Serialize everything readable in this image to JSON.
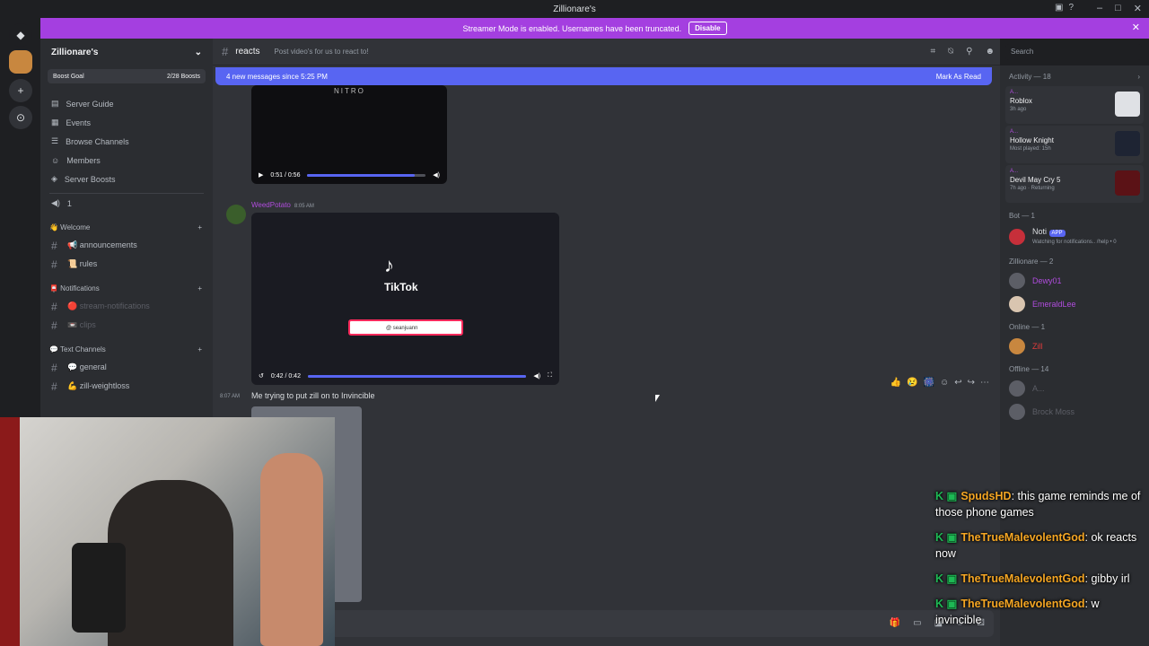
{
  "window": {
    "title": "Zillionare's"
  },
  "banner": {
    "text": "Streamer Mode is enabled. Usernames have been truncated.",
    "disable_label": "Disable"
  },
  "server": {
    "name": "Zillionare's",
    "boost_goal_label": "Boost Goal",
    "boost_count": "2/28 Boosts"
  },
  "sidebar": {
    "nav_items": [
      {
        "label": "Server Guide"
      },
      {
        "label": "Events"
      },
      {
        "label": "Browse Channels"
      },
      {
        "label": "Members"
      },
      {
        "label": "Server Boosts"
      }
    ],
    "voice_count": "1",
    "categories": [
      {
        "label": "👋 Welcome",
        "channels": [
          "📢 announcements",
          "📜 rules"
        ]
      },
      {
        "label": "📮 Notifications",
        "channels": [
          "🔴 stream-notifications",
          "📼 clips"
        ]
      },
      {
        "label": "💬 Text Channels",
        "channels": [
          "💬 general",
          "💪 zill-weightloss"
        ]
      }
    ]
  },
  "channel": {
    "name": "reacts",
    "topic": "Post video's for us to react to!"
  },
  "search": {
    "placeholder": "Search"
  },
  "new_messages": {
    "label": "4 new messages since 5:25 PM",
    "mark_read": "Mark As Read"
  },
  "messages": [
    {
      "video_time": "0:51 / 0:56",
      "progress": 0.91,
      "watermark": "NITRO"
    },
    {
      "author": "WeedPotato",
      "time": "8:05 AM",
      "video_brand": "TikTok",
      "video_handle": "@ seanjuann",
      "video_time": "0:42 / 0:42",
      "progress": 1.0
    },
    {
      "time": "8:07 AM",
      "text": "Me trying to put zill on to Invincible"
    }
  ],
  "members": {
    "activity_label": "Activity — 18",
    "activities": [
      {
        "name": "A...",
        "game": "Roblox",
        "sub": "3h ago"
      },
      {
        "name": "A...",
        "game": "Hollow Knight",
        "sub": "Most played: 15h"
      },
      {
        "name": "A...",
        "game": "Devil May Cry 5",
        "sub": "7h ago · Returning"
      }
    ],
    "bot_label": "Bot — 1",
    "bot": {
      "name": "Noti",
      "tag": "APP",
      "status": "Watching for notifications.. /help • 0"
    },
    "role_label": "Zillionare — 2",
    "role_members": [
      "Dewy01",
      "EmeraldLee"
    ],
    "online_label": "Online — 1",
    "online_members": [
      "Zill"
    ],
    "offline_label": "Offline — 14",
    "offline_members": [
      "A...",
      "Brock Moss"
    ]
  },
  "chat_overlay": [
    {
      "nick": "SpudsHD",
      "text": "this game reminds me of those phone games"
    },
    {
      "nick": "TheTrueMalevolentGod",
      "text": "ok reacts now"
    },
    {
      "nick": "TheTrueMalevolentGod",
      "text": "gibby irl"
    },
    {
      "nick": "TheTrueMalevolentGod",
      "text": "w invincible"
    }
  ]
}
